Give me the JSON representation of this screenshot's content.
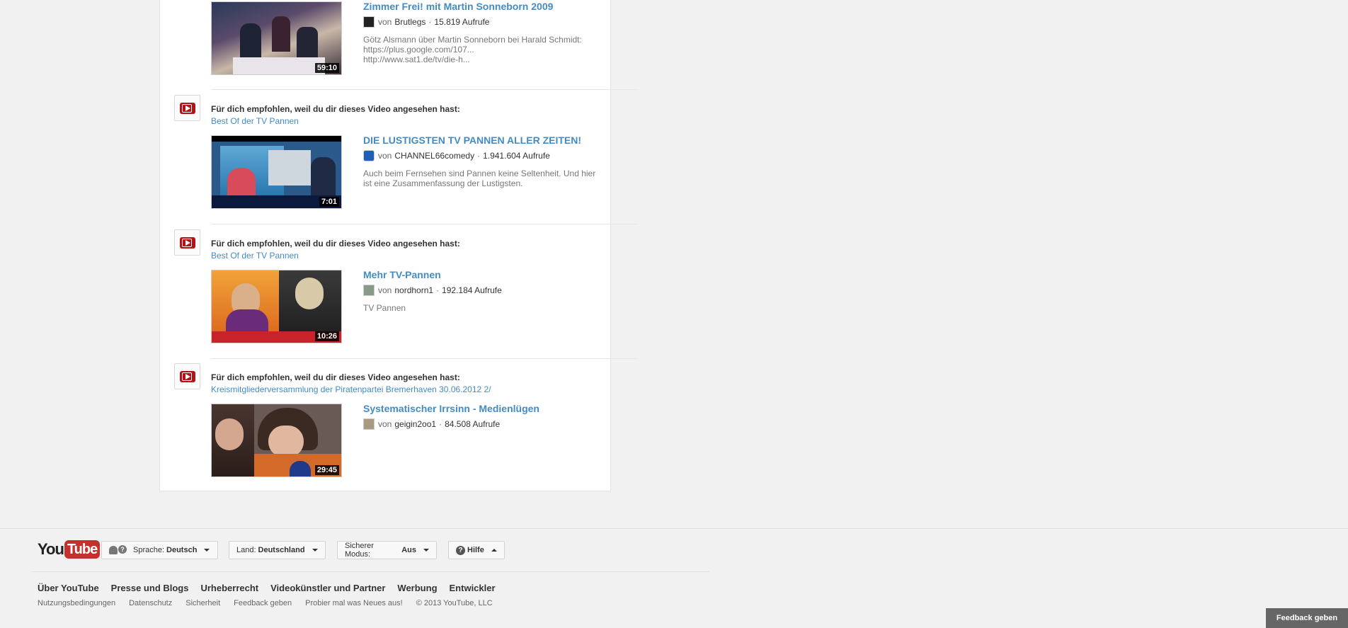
{
  "feed": {
    "items": [
      {
        "reason": "",
        "source": "",
        "title": "Zimmer Frei! mit Martin Sonneborn 2009",
        "by": "von",
        "channel": "Brutlegs",
        "views": "15.819 Aufrufe",
        "duration": "59:10",
        "desc": [
          "Götz Alsmann über Martin Sonneborn bei Harald Schmidt:",
          "https://plus.google.com/107...",
          "http://www.sat1.de/tv/die-h..."
        ]
      },
      {
        "reason": "Für dich empfohlen, weil du dir dieses Video angesehen hast:",
        "source": "Best Of der TV Pannen",
        "title": "DIE LUSTIGSTEN TV PANNEN ALLER ZEITEN!",
        "by": "von",
        "channel": "CHANNEL66comedy",
        "views": "1.941.604 Aufrufe",
        "duration": "7:01",
        "desc": [
          "Auch beim Fernsehen sind Pannen keine Seltenheit. Und hier",
          "ist eine Zusammenfassung der Lustigsten."
        ]
      },
      {
        "reason": "Für dich empfohlen, weil du dir dieses Video angesehen hast:",
        "source": "Best Of der TV Pannen",
        "title": "Mehr TV-Pannen",
        "by": "von",
        "channel": "nordhorn1",
        "views": "192.184 Aufrufe",
        "duration": "10:26",
        "desc": [
          "TV Pannen"
        ]
      },
      {
        "reason": "Für dich empfohlen, weil du dir dieses Video angesehen hast:",
        "source": "Kreismitgliederversammlung der Piratenpartei Bremerhaven 30.06.2012 2/",
        "title": "Systematischer Irrsinn - Medienlügen",
        "by": "von",
        "channel": "geigin2oo1",
        "views": "84.508 Aufrufe",
        "duration": "29:45",
        "desc": []
      }
    ],
    "separator": "·"
  },
  "footer": {
    "logo_you": "You",
    "logo_tube": "Tube",
    "language_label": "Sprache:",
    "language_value": "Deutsch",
    "country_label": "Land:",
    "country_value": "Deutschland",
    "safety_label": "Sicherer Modus:",
    "safety_value": "Aus",
    "help_label": "Hilfe",
    "primary_links": [
      "Über YouTube",
      "Presse und Blogs",
      "Urheberrecht",
      "Videokünstler und Partner",
      "Werbung",
      "Entwickler"
    ],
    "secondary_links": [
      "Nutzungsbedingungen",
      "Datenschutz",
      "Sicherheit",
      "Feedback geben",
      "Probier mal was Neues aus!"
    ],
    "copyright": "© 2013 YouTube, LLC",
    "feedback_button": "Feedback geben"
  },
  "colors": {
    "link_blue": "#438bc5",
    "youtube_red": "#c4302b",
    "icon_red": "#b31217"
  }
}
